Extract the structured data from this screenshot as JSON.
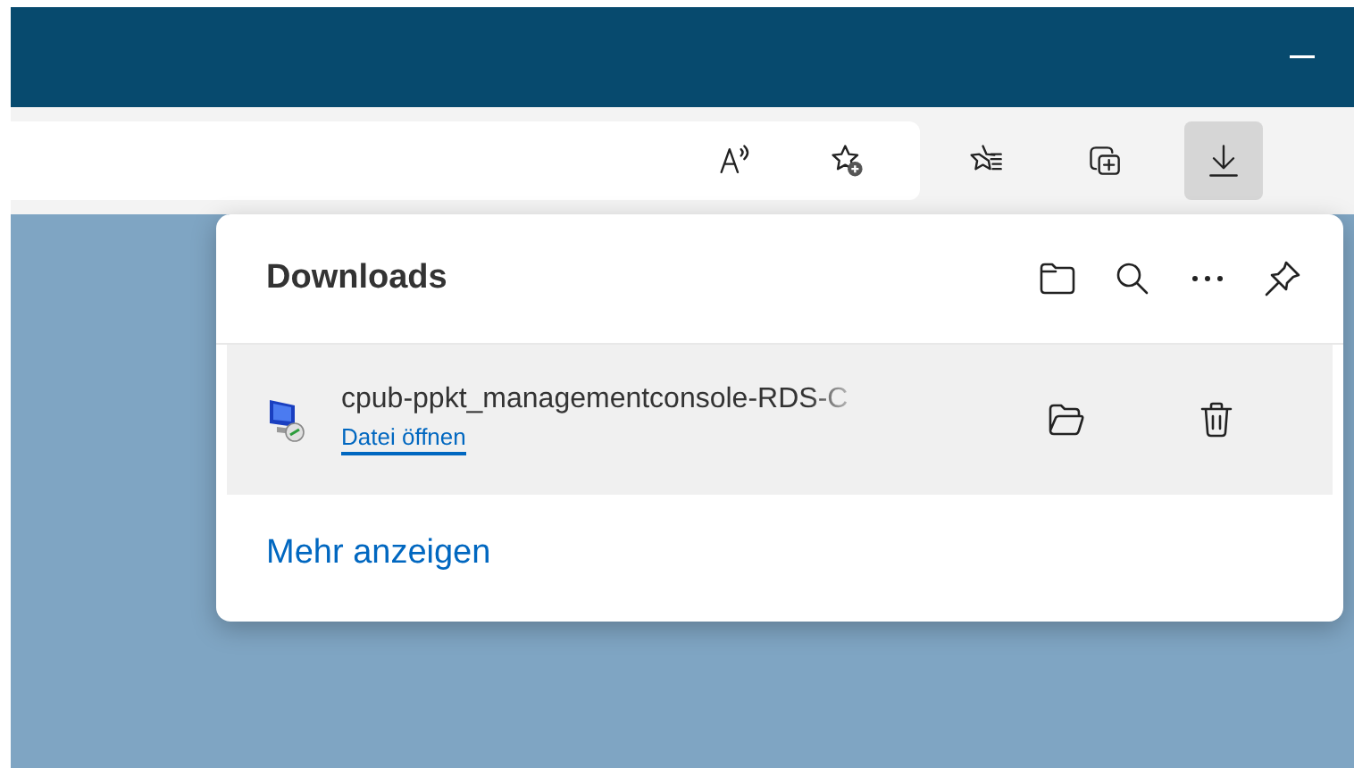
{
  "toolbar": {
    "buttons": [
      {
        "kind": "read-aloud",
        "selected": false
      },
      {
        "kind": "add-favorite",
        "selected": false
      },
      {
        "kind": "favorites",
        "selected": false
      },
      {
        "kind": "collections",
        "selected": false
      },
      {
        "kind": "downloads",
        "selected": true
      }
    ]
  },
  "downloads_panel": {
    "title": "Downloads",
    "header_actions": [
      {
        "kind": "folder"
      },
      {
        "kind": "search"
      },
      {
        "kind": "more"
      },
      {
        "kind": "pin"
      }
    ],
    "items": [
      {
        "filename": "cpub-ppkt_managementconsole-RDS-C",
        "link": "Datei öffnen",
        "actions": [
          {
            "kind": "open-folder"
          },
          {
            "kind": "delete"
          }
        ]
      }
    ],
    "footer_link": "Mehr anzeigen"
  }
}
